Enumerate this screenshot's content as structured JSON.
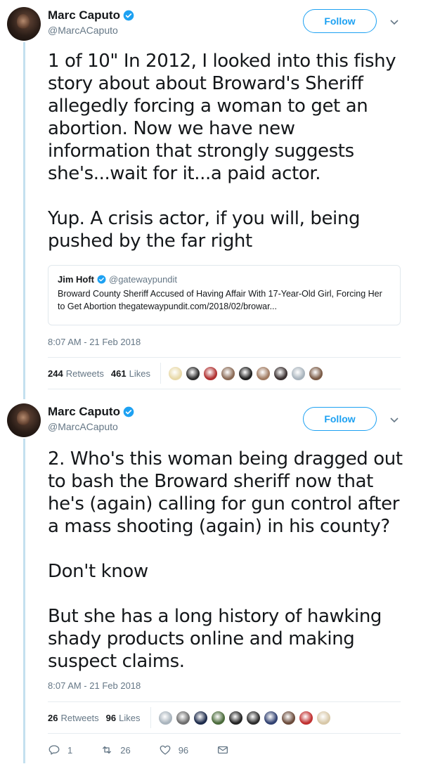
{
  "tweets": [
    {
      "author": {
        "name": "Marc Caputo",
        "handle": "@MarcACaputo",
        "verified": true
      },
      "follow_label": "Follow",
      "text": "1 of 10\" In 2012, I looked into this fishy story about about Broward's Sheriff allegedly forcing a woman to get an abortion. Now we have new information that strongly suggests she's...wait for it...a paid actor.\n\nYup. A crisis actor, if you will, being pushed by the far right",
      "quote": {
        "name": "Jim Hoft",
        "handle": "@gatewaypundit",
        "text": "Broward County Sheriff Accused of Having Affair With 17-Year-Old Girl, Forcing Her to Get Abortion thegatewaypundit.com/2018/02/browar..."
      },
      "timestamp": "8:07 AM - 21 Feb 2018",
      "retweets": {
        "count": "244",
        "label": "Retweets"
      },
      "likes": {
        "count": "461",
        "label": "Likes"
      },
      "liker_colors": [
        "#e8d9a8",
        "#2c2c2c",
        "#b03030",
        "#8a6a55",
        "#1f1f1f",
        "#a07a60",
        "#3a3030",
        "#a9b4bd",
        "#7a5a45"
      ]
    },
    {
      "author": {
        "name": "Marc Caputo",
        "handle": "@MarcACaputo",
        "verified": true
      },
      "follow_label": "Follow",
      "text": "2. Who's this woman being dragged out to bash the Broward sheriff now that he's (again) calling for gun control after a mass shooting (again) in his county?\n\nDon't know\n\nBut she has a long history of hawking shady products online and making suspect claims.",
      "timestamp": "8:07 AM - 21 Feb 2018",
      "retweets": {
        "count": "26",
        "label": "Retweets"
      },
      "likes": {
        "count": "96",
        "label": "Likes"
      },
      "liker_colors": [
        "#a9b4bd",
        "#6d6d6d",
        "#1c2a4a",
        "#4a6a3a",
        "#222222",
        "#2b2b2b",
        "#304070",
        "#6a4a3a",
        "#c03030",
        "#d8c8a8"
      ],
      "actions": {
        "replies": "1",
        "retweets": "26",
        "likes": "96"
      }
    }
  ],
  "colors": {
    "accent": "#1da1f2",
    "secondary_text": "#657786",
    "thread_line": "#c4e0ef"
  },
  "icons": [
    "verified-icon",
    "chevron-down-icon",
    "reply-icon",
    "retweet-icon",
    "like-icon",
    "message-icon"
  ]
}
